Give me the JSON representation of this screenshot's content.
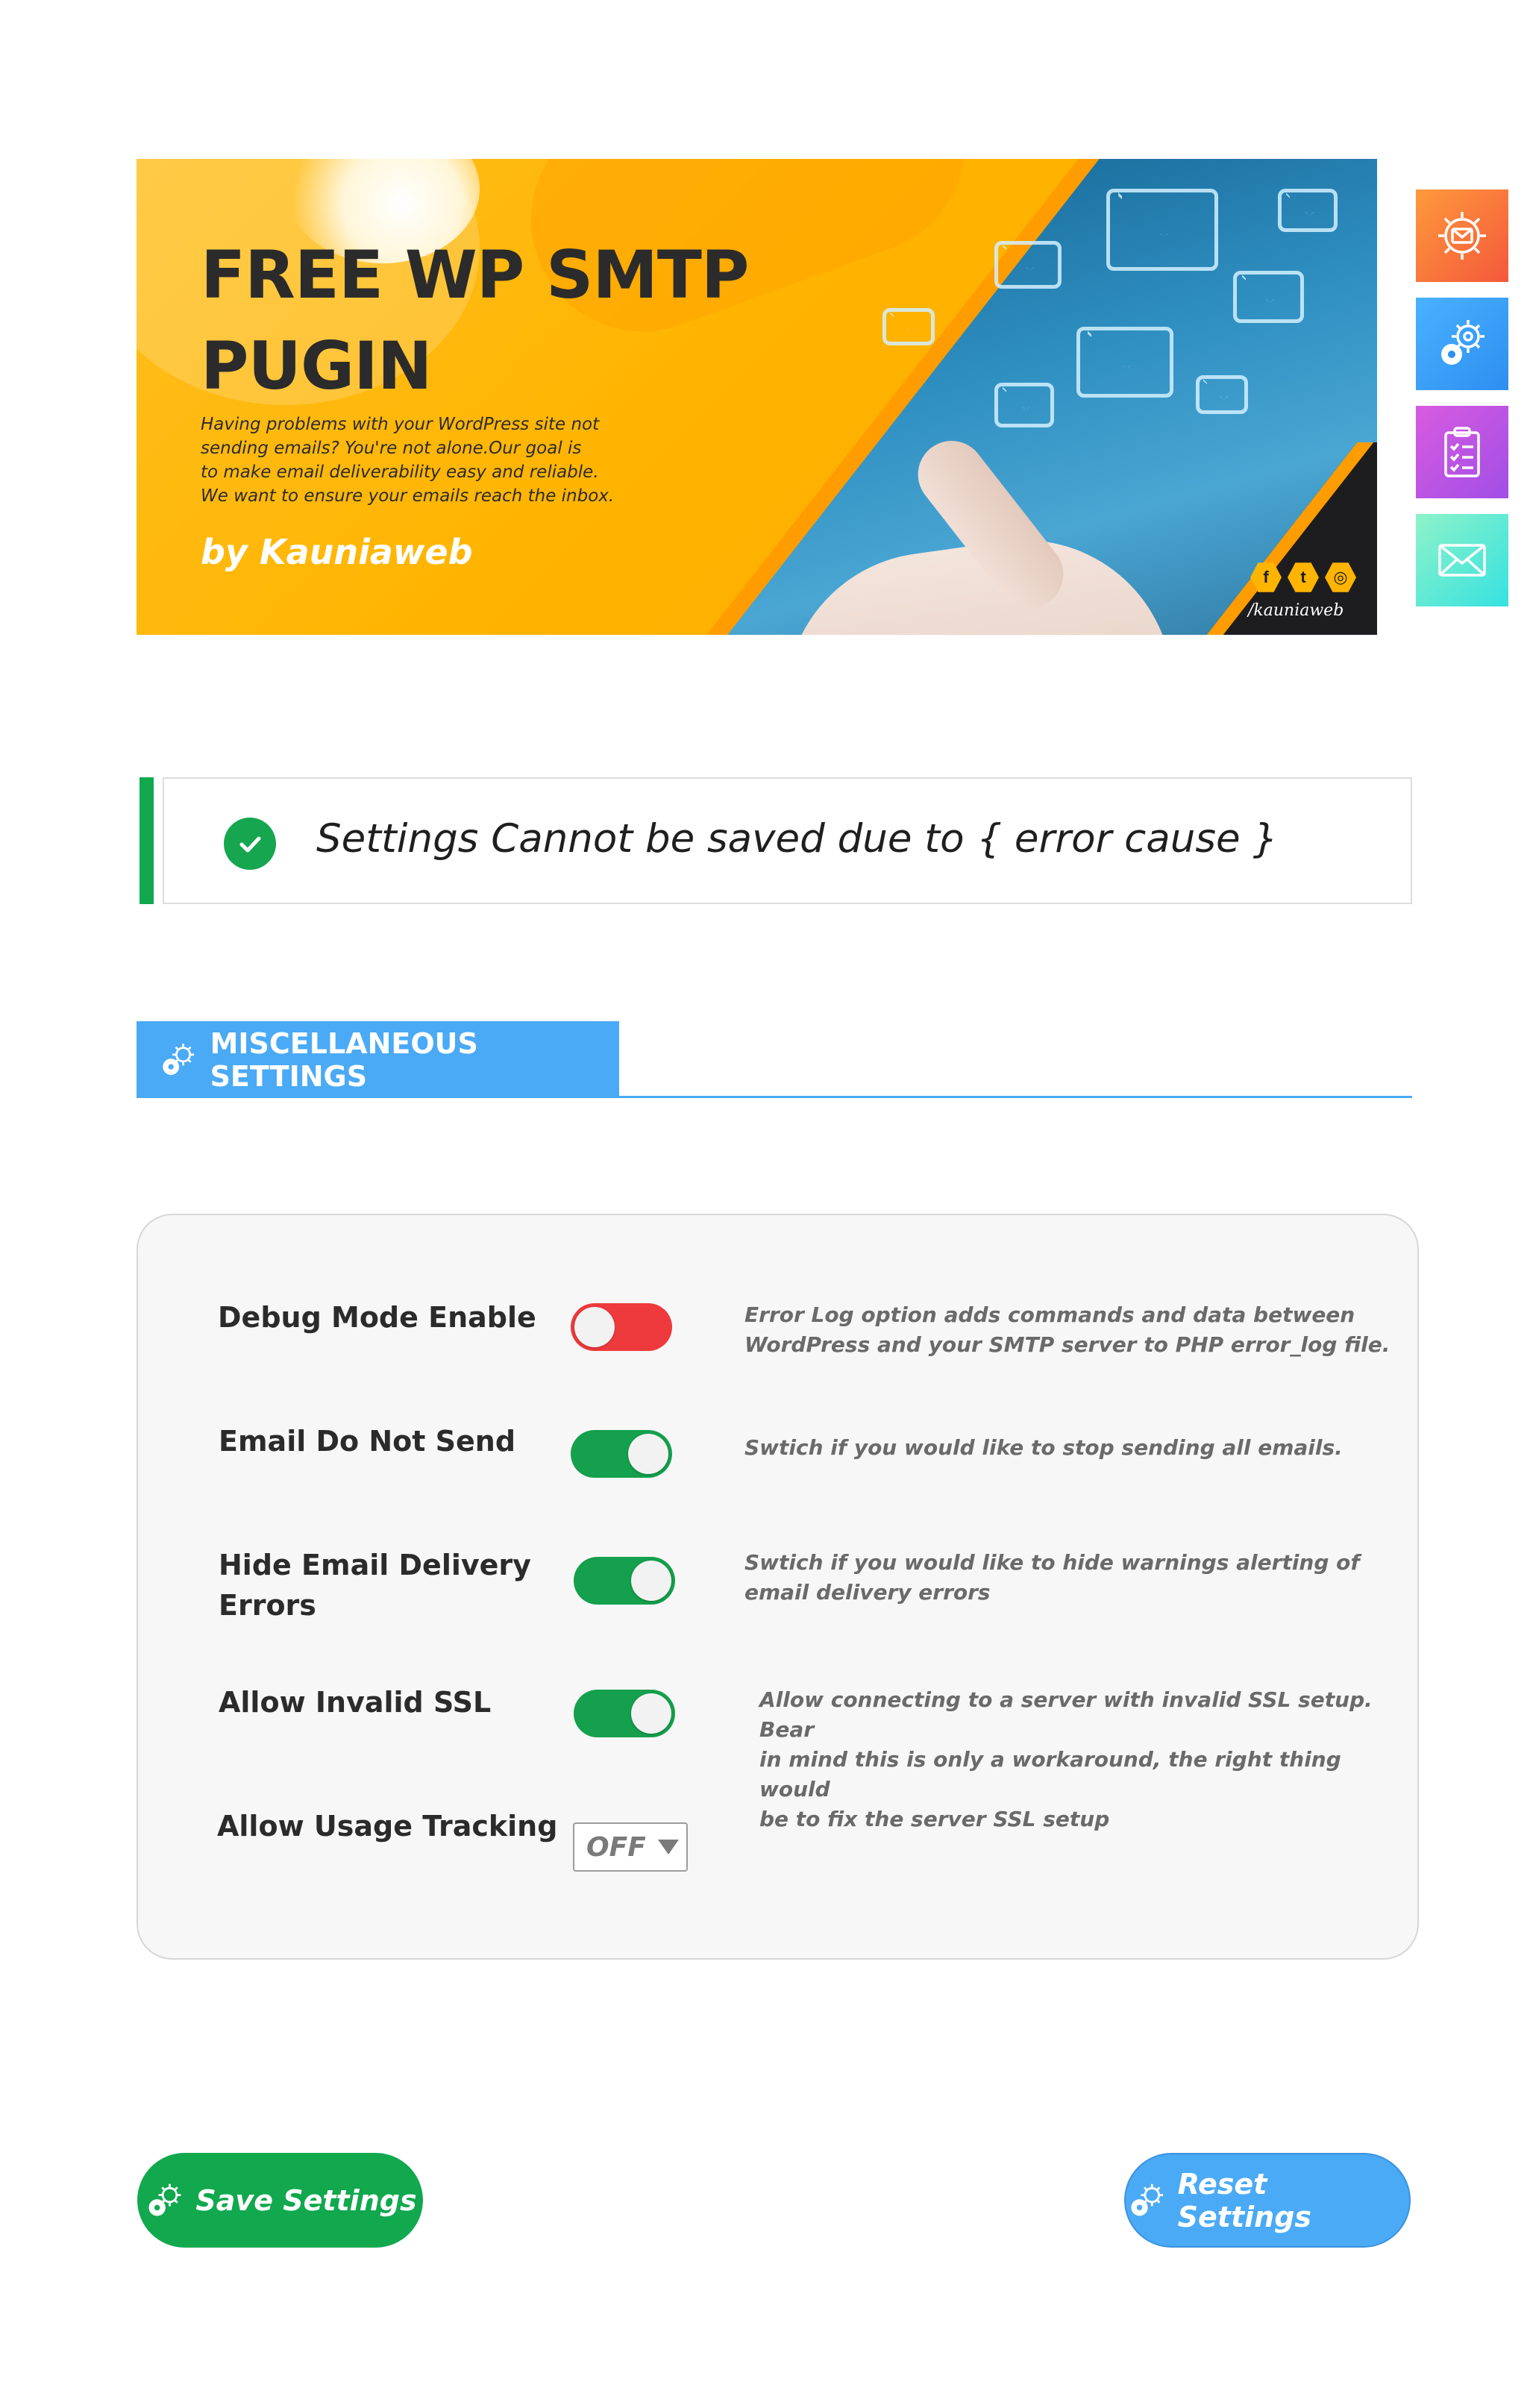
{
  "banner": {
    "title_line1": "FREE WP SMTP",
    "title_line2": "PUGIN",
    "tagline_lines": [
      "Having problems with your WordPress site not",
      "sending emails? You're not alone.Our goal is",
      "to make email deliverability easy and reliable.",
      "We want to ensure your emails reach the inbox."
    ],
    "byline": "by Kauniaweb",
    "social_icons": [
      "f",
      "t",
      "◎"
    ],
    "handle": "/kauniaweb",
    "accent_color": "#ffb400"
  },
  "side_nav": [
    {
      "icon": "gear-envelope-icon",
      "color": "#f3583b"
    },
    {
      "icon": "gear-icon",
      "color": "#2e8ef0"
    },
    {
      "icon": "clipboard-icon",
      "color": "#a14ee6"
    },
    {
      "icon": "envelope-icon",
      "color": "#36e1e0"
    }
  ],
  "notice": {
    "message": "Settings Cannot be saved due to { error cause }",
    "status_color": "#11a84e"
  },
  "section": {
    "title": "MISCELLANEOUS SETTINGS",
    "color": "#4aaaf6"
  },
  "settings": {
    "debug_mode": {
      "label": "Debug Mode Enable",
      "state": "off",
      "description_lines": [
        "Error Log option adds commands and data between",
        "WordPress and your SMTP server to PHP error_log file."
      ]
    },
    "email_do_not_send": {
      "label": "Email Do Not Send",
      "state": "on",
      "description_lines": [
        "Swtich if you would like to stop sending all emails."
      ]
    },
    "hide_delivery_errors": {
      "label_lines": [
        "Hide Email Delivery",
        "Errors"
      ],
      "state": "on",
      "description_lines": [
        "Swtich if you would like to hide warnings alerting of",
        "email delivery errors"
      ]
    },
    "allow_invalid_ssl": {
      "label": "Allow Invalid SSL",
      "state": "on",
      "description_lines": [
        "Allow connecting to a server with invalid SSL setup. Bear",
        "in mind this is only a workaround, the right thing would",
        "be to fix the server SSL setup"
      ]
    },
    "usage_tracking": {
      "label": "Allow Usage Tracking",
      "selected": "OFF"
    }
  },
  "buttons": {
    "save": "Save Settings",
    "reset": "Reset Settings",
    "save_color": "#11a84e",
    "reset_color": "#4aaaf6"
  }
}
